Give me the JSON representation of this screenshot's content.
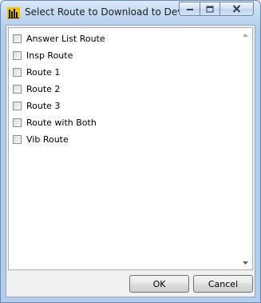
{
  "window": {
    "title": "Select Route to Download to Device"
  },
  "icons": {
    "app": "app-logo-icon",
    "minimize": "minimize-icon",
    "maximize": "maximize-icon",
    "close": "close-icon",
    "scroll_up": "scroll-up-arrow-icon",
    "scroll_down": "scroll-down-arrow-icon"
  },
  "routes": [
    {
      "label": "Answer List Route",
      "checked": false
    },
    {
      "label": "Insp Route",
      "checked": false
    },
    {
      "label": "Route 1",
      "checked": false
    },
    {
      "label": "Route 2",
      "checked": false
    },
    {
      "label": "Route 3",
      "checked": false
    },
    {
      "label": "Route with Both",
      "checked": false
    },
    {
      "label": "Vib Route",
      "checked": false
    }
  ],
  "buttons": {
    "ok_label": "OK",
    "cancel_label": "Cancel"
  },
  "colors": {
    "titlebar": "#c5daf3",
    "close_hover": "#c75050",
    "client_bg": "#f0f0f0"
  }
}
